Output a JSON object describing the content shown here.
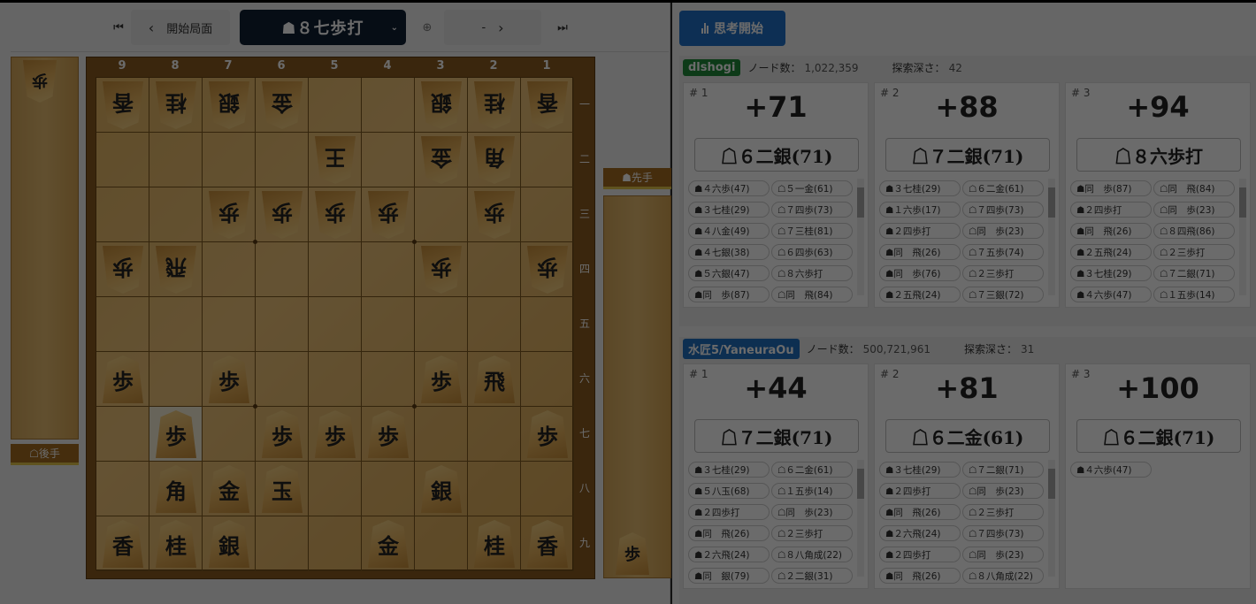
{
  "toolbar": {
    "first_icon": "⏮",
    "prev_icon": "‹",
    "start_label": "開始局面",
    "move_select": "☗８七歩打",
    "caret": "⌄",
    "add_icon": "⊕",
    "dash": "-",
    "next_icon": "›",
    "last_icon": "⏭"
  },
  "board": {
    "files": [
      "9",
      "8",
      "7",
      "6",
      "5",
      "4",
      "3",
      "2",
      "1"
    ],
    "ranks": [
      "一",
      "二",
      "三",
      "四",
      "五",
      "六",
      "七",
      "八",
      "九"
    ],
    "sente_label": "☗先手",
    "gote_label": "☖後手",
    "gote_hand": [
      {
        "char": "歩"
      }
    ],
    "sente_hand": [
      {
        "char": "歩"
      }
    ],
    "highlight": [
      {
        "file": 8,
        "rank": 7
      }
    ],
    "pieces": [
      {
        "file": 9,
        "rank": 1,
        "char": "香",
        "side": "gote"
      },
      {
        "file": 8,
        "rank": 1,
        "char": "桂",
        "side": "gote"
      },
      {
        "file": 7,
        "rank": 1,
        "char": "銀",
        "side": "gote"
      },
      {
        "file": 6,
        "rank": 1,
        "char": "金",
        "side": "gote"
      },
      {
        "file": 3,
        "rank": 1,
        "char": "銀",
        "side": "gote"
      },
      {
        "file": 2,
        "rank": 1,
        "char": "桂",
        "side": "gote"
      },
      {
        "file": 1,
        "rank": 1,
        "char": "香",
        "side": "gote"
      },
      {
        "file": 5,
        "rank": 2,
        "char": "王",
        "side": "gote"
      },
      {
        "file": 3,
        "rank": 2,
        "char": "金",
        "side": "gote"
      },
      {
        "file": 2,
        "rank": 2,
        "char": "角",
        "side": "gote"
      },
      {
        "file": 7,
        "rank": 3,
        "char": "歩",
        "side": "gote"
      },
      {
        "file": 6,
        "rank": 3,
        "char": "歩",
        "side": "gote"
      },
      {
        "file": 5,
        "rank": 3,
        "char": "歩",
        "side": "gote"
      },
      {
        "file": 4,
        "rank": 3,
        "char": "歩",
        "side": "gote"
      },
      {
        "file": 2,
        "rank": 3,
        "char": "歩",
        "side": "gote"
      },
      {
        "file": 9,
        "rank": 4,
        "char": "歩",
        "side": "gote"
      },
      {
        "file": 8,
        "rank": 4,
        "char": "飛",
        "side": "gote"
      },
      {
        "file": 3,
        "rank": 4,
        "char": "歩",
        "side": "gote"
      },
      {
        "file": 1,
        "rank": 4,
        "char": "歩",
        "side": "gote"
      },
      {
        "file": 9,
        "rank": 6,
        "char": "歩",
        "side": "sente"
      },
      {
        "file": 7,
        "rank": 6,
        "char": "歩",
        "side": "sente"
      },
      {
        "file": 3,
        "rank": 6,
        "char": "歩",
        "side": "sente"
      },
      {
        "file": 2,
        "rank": 6,
        "char": "飛",
        "side": "sente"
      },
      {
        "file": 8,
        "rank": 7,
        "char": "歩",
        "side": "sente"
      },
      {
        "file": 6,
        "rank": 7,
        "char": "歩",
        "side": "sente"
      },
      {
        "file": 5,
        "rank": 7,
        "char": "歩",
        "side": "sente"
      },
      {
        "file": 4,
        "rank": 7,
        "char": "歩",
        "side": "sente"
      },
      {
        "file": 1,
        "rank": 7,
        "char": "歩",
        "side": "sente"
      },
      {
        "file": 8,
        "rank": 8,
        "char": "角",
        "side": "sente"
      },
      {
        "file": 7,
        "rank": 8,
        "char": "金",
        "side": "sente"
      },
      {
        "file": 6,
        "rank": 8,
        "char": "玉",
        "side": "sente"
      },
      {
        "file": 3,
        "rank": 8,
        "char": "銀",
        "side": "sente"
      },
      {
        "file": 9,
        "rank": 9,
        "char": "香",
        "side": "sente"
      },
      {
        "file": 8,
        "rank": 9,
        "char": "桂",
        "side": "sente"
      },
      {
        "file": 7,
        "rank": 9,
        "char": "銀",
        "side": "sente"
      },
      {
        "file": 4,
        "rank": 9,
        "char": "金",
        "side": "sente"
      },
      {
        "file": 2,
        "rank": 9,
        "char": "桂",
        "side": "sente"
      },
      {
        "file": 1,
        "rank": 9,
        "char": "香",
        "side": "sente"
      }
    ]
  },
  "think_button": {
    "icon": "bar-chart-icon",
    "label": "思考開始"
  },
  "engines": [
    {
      "name": "dlshogi",
      "color": "#1f8a3a",
      "nodes_label": "ノード数：",
      "nodes": "1,022,359",
      "depth_label": "探索深さ：",
      "depth": "42",
      "pvs": [
        {
          "idx": "# 1",
          "score": "+71",
          "best": "☖６二銀(71)",
          "moves": [
            "☗４六歩(47)",
            "☖５一金(61)",
            "☗３七桂(29)",
            "☖７四歩(73)",
            "☗４八金(49)",
            "☖７三桂(81)",
            "☗４七銀(38)",
            "☖６四歩(63)",
            "☗５六銀(47)",
            "☖８六歩打",
            "☗同　歩(87)",
            "☖同　飛(84)"
          ]
        },
        {
          "idx": "# 2",
          "score": "+88",
          "best": "☖７二銀(71)",
          "moves": [
            "☗３七桂(29)",
            "☖６二金(61)",
            "☗１六歩(17)",
            "☖７四歩(73)",
            "☗２四歩打",
            "☖同　歩(23)",
            "☗同　飛(26)",
            "☖７五歩(74)",
            "☗同　歩(76)",
            "☖２三歩打",
            "☗２五飛(24)",
            "☖７三銀(72)"
          ]
        },
        {
          "idx": "# 3",
          "score": "+94",
          "best": "☖８六歩打",
          "moves": [
            "☗同　歩(87)",
            "☖同　飛(84)",
            "☗２四歩打",
            "☖同　歩(23)",
            "☗同　飛(26)",
            "☖８四飛(86)",
            "☗２五飛(24)",
            "☖２三歩打",
            "☗３七桂(29)",
            "☖７二銀(71)",
            "☗４六歩(47)",
            "☖１五歩(14)"
          ]
        }
      ]
    },
    {
      "name": "水匠5/YaneuraOu",
      "color": "#1f6fc0",
      "nodes_label": "ノード数：",
      "nodes": "500,721,961",
      "depth_label": "探索深さ：",
      "depth": "31",
      "pvs": [
        {
          "idx": "# 1",
          "score": "+44",
          "best": "☖７二銀(71)",
          "moves": [
            "☗３七桂(29)",
            "☖６二金(61)",
            "☗５八玉(68)",
            "☖１五歩(14)",
            "☗２四歩打",
            "☖同　歩(23)",
            "☗同　飛(26)",
            "☖２三歩打",
            "☗２六飛(24)",
            "☖８八角成(22)",
            "☗同　銀(79)",
            "☖２二銀(31)"
          ]
        },
        {
          "idx": "# 2",
          "score": "+81",
          "best": "☖６二金(61)",
          "moves": [
            "☗３七桂(29)",
            "☖７二銀(71)",
            "☗２四歩打",
            "☖同　歩(23)",
            "☗同　飛(26)",
            "☖２三歩打",
            "☗２六飛(24)",
            "☖７四歩(73)",
            "☗２四歩打",
            "☖同　歩(23)",
            "☗同　飛(26)",
            "☖８八角成(22)"
          ]
        },
        {
          "idx": "# 3",
          "score": "+100",
          "best": "☖６二銀(71)",
          "moves": [
            "☗４六歩(47)"
          ]
        }
      ]
    }
  ]
}
